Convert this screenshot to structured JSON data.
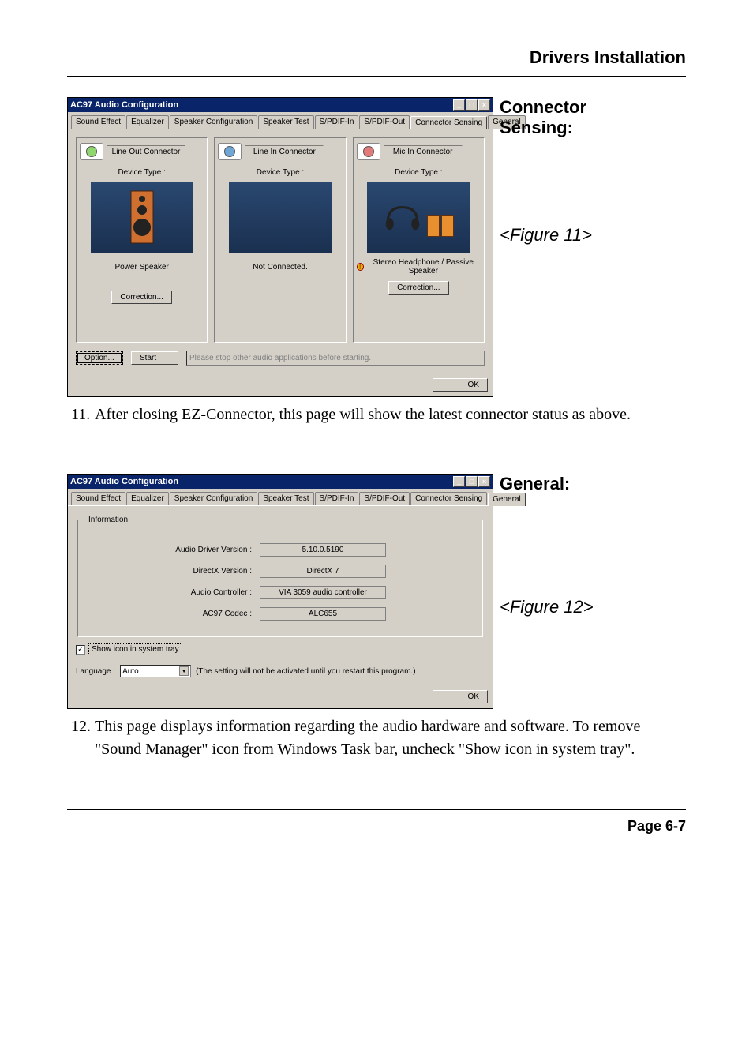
{
  "page_header": "Drivers Installation",
  "side1": {
    "title1": "Connector",
    "title2": "Sensing:",
    "fig": "<Figure 11>"
  },
  "side2": {
    "title": "General:",
    "fig": "<Figure 12>"
  },
  "win": {
    "title": "AC97 Audio Configuration",
    "tabs": [
      "Sound Effect",
      "Equalizer",
      "Speaker Configuration",
      "Speaker Test",
      "S/PDIF-In",
      "S/PDIF-Out",
      "Connector Sensing",
      "General"
    ],
    "cs": {
      "connectors": [
        {
          "label": "Line Out Connector",
          "dev_type": "Device Type :",
          "result": "Power Speaker",
          "correction": "Correction...",
          "jack": "#8fd66f"
        },
        {
          "label": "Line In Connector",
          "dev_type": "Device Type :",
          "result": "Not Connected.",
          "correction": "",
          "jack": "#6fa6d6"
        },
        {
          "label": "Mic In Connector",
          "dev_type": "Device Type :",
          "result": "Stereo Headphone / Passive Speaker",
          "correction": "Correction...",
          "jack": "#e37a7a"
        }
      ],
      "option_btn": "Option...",
      "start_btn": "Start",
      "note": "Please stop other audio applications before starting."
    },
    "general": {
      "legend": "Information",
      "rows": [
        {
          "label": "Audio Driver Version :",
          "val": "5.10.0.5190"
        },
        {
          "label": "DirectX Version :",
          "val": "DirectX 7"
        },
        {
          "label": "Audio Controller :",
          "val": "VIA 3059 audio controller"
        },
        {
          "label": "AC97 Codec :",
          "val": "ALC655"
        }
      ],
      "show_tray": "Show icon in system tray",
      "language_lbl": "Language :",
      "language_val": "Auto",
      "lang_note": "(The setting will not be activated until you restart this program.)"
    },
    "ok": "OK"
  },
  "body11_num": "11.",
  "body11": "After closing EZ-Connector, this page will show the latest connector status as above.",
  "body12_num": "12.",
  "body12": "This page displays information regarding the audio hardware and software. To remove \"Sound Manager\" icon from Windows Task bar, uncheck \"Show icon in system tray\".",
  "footer": "Page 6-7"
}
